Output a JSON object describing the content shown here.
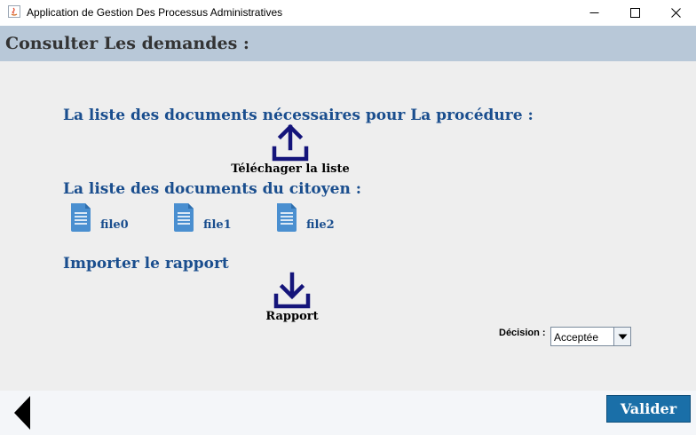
{
  "window": {
    "title": "Application de Gestion Des Processus Administratives"
  },
  "page": {
    "title": "Consulter Les demandes :"
  },
  "sections": {
    "procedure_heading": "La liste des documents nécessaires pour La procédure :",
    "download_label": "Téléchager la liste",
    "citizen_heading": "La liste des documents du citoyen :",
    "report_heading": "Importer le rapport",
    "report_label": "Rapport"
  },
  "files": [
    "file0",
    "file1",
    "file2"
  ],
  "decision": {
    "label": "Décision :",
    "value": "Acceptée"
  },
  "footer": {
    "validate_label": "Valider"
  },
  "icons": {
    "upload": "upload-icon",
    "download": "download-icon",
    "document": "document-icon",
    "back": "back-arrow-icon"
  },
  "colors": {
    "header_band": "#b8c8d8",
    "heading_text": "#1a4e8e",
    "icon_navy": "#14147a",
    "doc_icon": "#4a8fd0",
    "validate_button": "#1a6fa8"
  }
}
